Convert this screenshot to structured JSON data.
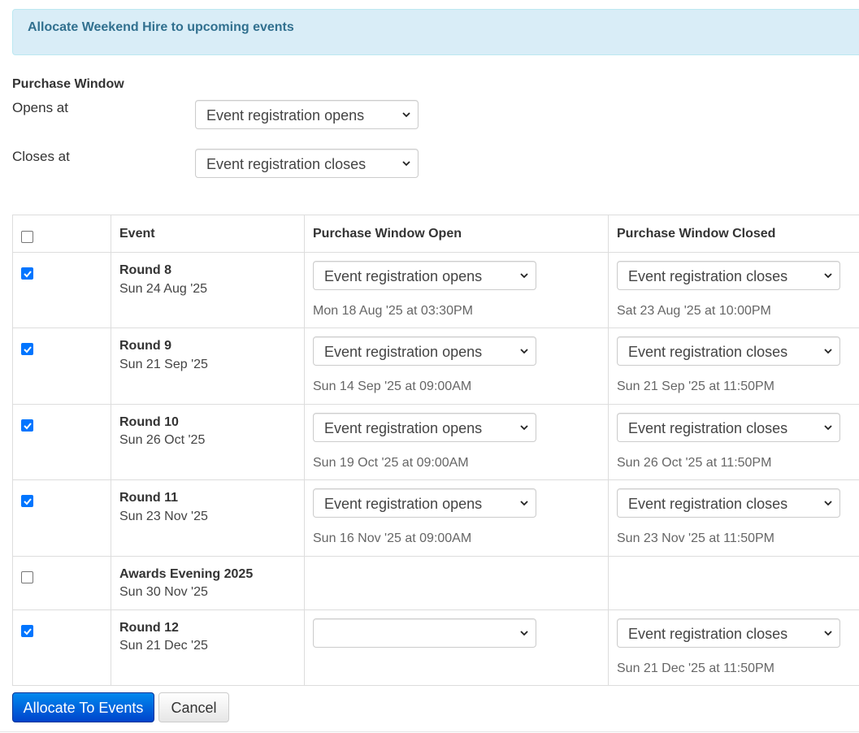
{
  "alert": {
    "text": "Allocate Weekend Hire to upcoming events"
  },
  "purchase_window": {
    "title": "Purchase Window",
    "opens_label": "Opens at",
    "opens_value": "Event registration opens",
    "closes_label": "Closes at",
    "closes_value": "Event registration closes"
  },
  "table": {
    "headers": {
      "event": "Event",
      "open": "Purchase Window Open",
      "closed": "Purchase Window Closed"
    },
    "rows": [
      {
        "name": "Round 8",
        "date": "Sun 24 Aug '25",
        "checked": true,
        "open_select": "Event registration opens",
        "open_time": "Mon 18 Aug '25 at 03:30PM",
        "close_select": "Event registration closes",
        "close_time": "Sat 23 Aug '25 at 10:00PM"
      },
      {
        "name": "Round 9",
        "date": "Sun 21 Sep '25",
        "checked": true,
        "open_select": "Event registration opens",
        "open_time": "Sun 14 Sep '25 at 09:00AM",
        "close_select": "Event registration closes",
        "close_time": "Sun 21 Sep '25 at 11:50PM"
      },
      {
        "name": "Round 10",
        "date": "Sun 26 Oct '25",
        "checked": true,
        "open_select": "Event registration opens",
        "open_time": "Sun 19 Oct '25 at 09:00AM",
        "close_select": "Event registration closes",
        "close_time": "Sun 26 Oct '25 at 11:50PM"
      },
      {
        "name": "Round 11",
        "date": "Sun 23 Nov '25",
        "checked": true,
        "open_select": "Event registration opens",
        "open_time": "Sun 16 Nov '25 at 09:00AM",
        "close_select": "Event registration closes",
        "close_time": "Sun 23 Nov '25 at 11:50PM"
      },
      {
        "name": "Awards Evening 2025",
        "date": "Sun 30 Nov '25",
        "checked": false
      },
      {
        "name": "Round 12",
        "date": "Sun 21 Dec '25",
        "checked": true,
        "open_select": "",
        "close_select": "Event registration closes",
        "close_time": "Sun 21 Dec '25 at 11:50PM"
      }
    ]
  },
  "buttons": {
    "allocate": "Allocate To Events",
    "cancel": "Cancel"
  },
  "colors": {
    "alert_bg": "#d9edf7",
    "alert_text": "#31708f",
    "primary": "#0044cc",
    "checkbox": "#0075ff"
  },
  "icons": {
    "select_arrow": "chevron-down-icon",
    "checkbox_mark": "check-icon"
  }
}
